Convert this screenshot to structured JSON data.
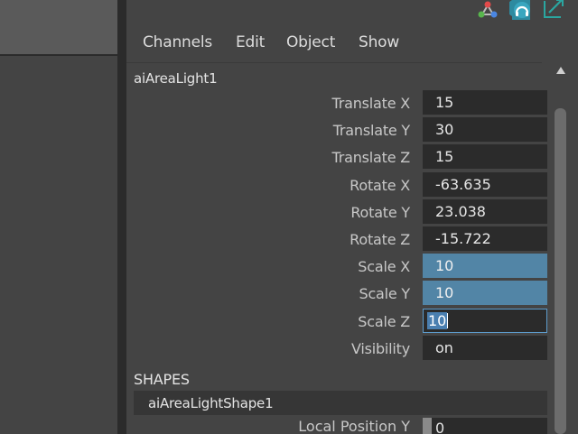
{
  "menu": [
    "Channels",
    "Edit",
    "Object",
    "Show"
  ],
  "node_name": "aiAreaLight1",
  "attributes": [
    {
      "label": "Translate X",
      "value": "15",
      "state": "normal"
    },
    {
      "label": "Translate Y",
      "value": "30",
      "state": "normal"
    },
    {
      "label": "Translate Z",
      "value": "15",
      "state": "normal"
    },
    {
      "label": "Rotate X",
      "value": "-63.635",
      "state": "normal"
    },
    {
      "label": "Rotate Y",
      "value": "23.038",
      "state": "normal"
    },
    {
      "label": "Rotate Z",
      "value": "-15.722",
      "state": "normal"
    },
    {
      "label": "Scale X",
      "value": "10",
      "state": "selected"
    },
    {
      "label": "Scale Y",
      "value": "10",
      "state": "selected"
    },
    {
      "label": "Scale Z",
      "value": "10",
      "state": "editing"
    },
    {
      "label": "Visibility",
      "value": "on",
      "state": "normal"
    }
  ],
  "shapes_header": "SHAPES",
  "shape_name": "aiAreaLightShape1",
  "partial_row": {
    "label": "Local Position Y",
    "value": "0"
  },
  "icons": [
    "node-editor-icon",
    "headphones-icon",
    "expand-icon"
  ],
  "colors": {
    "panel_bg": "#444444",
    "field_bg": "#2b2b2b",
    "selected_field": "#5285a6",
    "edit_border": "#5d9ccc",
    "separator": "#2b2b2b"
  }
}
